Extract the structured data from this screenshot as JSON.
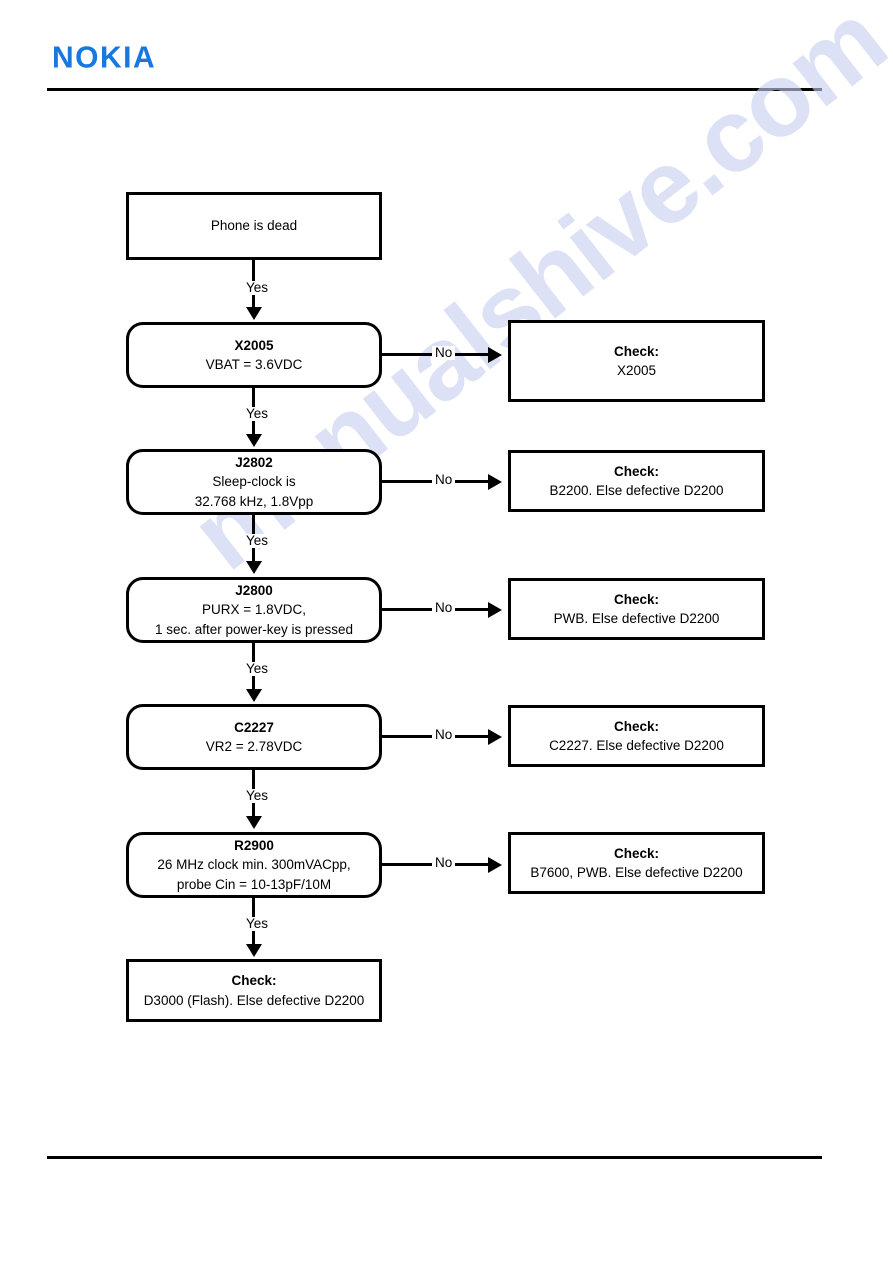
{
  "header": {
    "brand": "NOKIA",
    "brand_color": "#1878e0"
  },
  "watermark": {
    "text": "manualshive.com",
    "color": "#c9cff0"
  },
  "flowchart": {
    "title": "Phone is dead troubleshooting",
    "edge_label_yes": "Yes",
    "edge_label_no": "No",
    "start": {
      "title": "Phone is dead"
    },
    "steps": [
      {
        "id": "x2005",
        "title": "X2005",
        "lines": [
          "VBAT = 3.6VDC"
        ],
        "fail": {
          "title": "Check:",
          "lines": [
            "X2005"
          ]
        }
      },
      {
        "id": "j2802",
        "title": "J2802",
        "lines": [
          "Sleep-clock is",
          "32.768 kHz, 1.8Vpp"
        ],
        "fail": {
          "title": "Check:",
          "lines": [
            "B2200. Else defective D2200"
          ]
        }
      },
      {
        "id": "j2800",
        "title": "J2800",
        "lines": [
          "PURX = 1.8VDC,",
          "1 sec. after power-key is pressed"
        ],
        "fail": {
          "title": "Check:",
          "lines": [
            "PWB. Else defective D2200"
          ]
        }
      },
      {
        "id": "c2227",
        "title": "C2227",
        "lines": [
          "VR2 = 2.78VDC"
        ],
        "fail": {
          "title": "Check:",
          "lines": [
            "C2227. Else defective D2200"
          ]
        }
      },
      {
        "id": "r2900",
        "title": "R2900",
        "lines": [
          "26 MHz clock min. 300mVACpp,",
          "probe Cin = 10-13pF/10M"
        ],
        "fail": {
          "title": "Check:",
          "lines": [
            "B7600, PWB. Else defective D2200"
          ]
        }
      }
    ],
    "end": {
      "title": "Check:",
      "lines": [
        "D3000 (Flash). Else defective D2200"
      ]
    }
  }
}
